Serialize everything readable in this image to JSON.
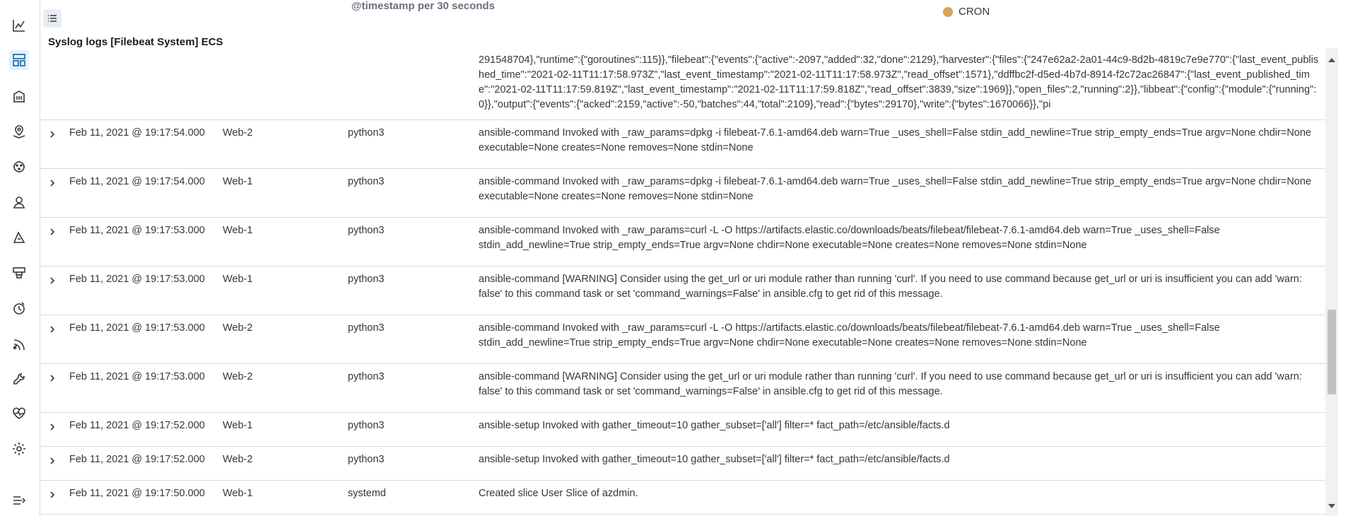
{
  "header": {
    "chart_xlabel": "@timestamp per 30 seconds",
    "legend_label": "CRON",
    "legend_color": "#d6a35c",
    "panel_title": "Syslog logs [Filebeat System] ECS"
  },
  "nav": {
    "icons": [
      "chart-icon",
      "dashboard-icon",
      "building-icon",
      "maps-icon",
      "ml-icon",
      "graph-icon",
      "security-icon",
      "infra-icon",
      "uptime-icon",
      "apm-icon",
      "dev-tools-icon",
      "monitoring-icon",
      "settings-icon",
      "collapse-icon"
    ]
  },
  "expanded_message": "291548704},\"runtime\":{\"goroutines\":115}},\"filebeat\":{\"events\":{\"active\":-2097,\"added\":32,\"done\":2129},\"harvester\":{\"files\":{\"247e62a2-2a01-44c9-8d2b-4819c7e9e770\":{\"last_event_published_time\":\"2021-02-11T11:17:58.973Z\",\"last_event_timestamp\":\"2021-02-11T11:17:58.973Z\",\"read_offset\":1571},\"ddffbc2f-d5ed-4b7d-8914-f2c72ac26847\":{\"last_event_published_time\":\"2021-02-11T11:17:59.819Z\",\"last_event_timestamp\":\"2021-02-11T11:17:59.818Z\",\"read_offset\":3839,\"size\":1969}},\"open_files\":2,\"running\":2}},\"libbeat\":{\"config\":{\"module\":{\"running\":0}},\"output\":{\"events\":{\"acked\":2159,\"active\":-50,\"batches\":44,\"total\":2109},\"read\":{\"bytes\":29170},\"write\":{\"bytes\":1670066}},\"pi",
  "rows": [
    {
      "time": "Feb 11, 2021 @ 19:17:54.000",
      "host": "Web-2",
      "process": "python3",
      "message": "ansible-command Invoked with _raw_params=dpkg -i filebeat-7.6.1-amd64.deb warn=True _uses_shell=False stdin_add_newline=True strip_empty_ends=True argv=None chdir=None executable=None creates=None removes=None stdin=None"
    },
    {
      "time": "Feb 11, 2021 @ 19:17:54.000",
      "host": "Web-1",
      "process": "python3",
      "message": "ansible-command Invoked with _raw_params=dpkg -i filebeat-7.6.1-amd64.deb warn=True _uses_shell=False stdin_add_newline=True strip_empty_ends=True argv=None chdir=None executable=None creates=None removes=None stdin=None"
    },
    {
      "time": "Feb 11, 2021 @ 19:17:53.000",
      "host": "Web-1",
      "process": "python3",
      "message": "ansible-command Invoked with _raw_params=curl -L -O https://artifacts.elastic.co/downloads/beats/filebeat/filebeat-7.6.1-amd64.deb warn=True _uses_shell=False stdin_add_newline=True strip_empty_ends=True argv=None chdir=None executable=None creates=None removes=None stdin=None"
    },
    {
      "time": "Feb 11, 2021 @ 19:17:53.000",
      "host": "Web-1",
      "process": "python3",
      "message": "ansible-command [WARNING] Consider using the get_url or uri module rather than running 'curl'.  If you need to use command because get_url or uri is insufficient you can add 'warn: false' to this command task or set 'command_warnings=False' in ansible.cfg to get rid of this message."
    },
    {
      "time": "Feb 11, 2021 @ 19:17:53.000",
      "host": "Web-2",
      "process": "python3",
      "message": "ansible-command Invoked with _raw_params=curl -L -O https://artifacts.elastic.co/downloads/beats/filebeat/filebeat-7.6.1-amd64.deb warn=True _uses_shell=False stdin_add_newline=True strip_empty_ends=True argv=None chdir=None executable=None creates=None removes=None stdin=None"
    },
    {
      "time": "Feb 11, 2021 @ 19:17:53.000",
      "host": "Web-2",
      "process": "python3",
      "message": "ansible-command [WARNING] Consider using the get_url or uri module rather than running 'curl'.  If you need to use command because get_url or uri is insufficient you can add 'warn: false' to this command task or set 'command_warnings=False' in ansible.cfg to get rid of this message."
    },
    {
      "time": "Feb 11, 2021 @ 19:17:52.000",
      "host": "Web-1",
      "process": "python3",
      "message": "ansible-setup Invoked with gather_timeout=10 gather_subset=['all'] filter=* fact_path=/etc/ansible/facts.d"
    },
    {
      "time": "Feb 11, 2021 @ 19:17:52.000",
      "host": "Web-2",
      "process": "python3",
      "message": "ansible-setup Invoked with gather_timeout=10 gather_subset=['all'] filter=* fact_path=/etc/ansible/facts.d"
    },
    {
      "time": "Feb 11, 2021 @ 19:17:50.000",
      "host": "Web-1",
      "process": "systemd",
      "message": "Created slice User Slice of azdmin."
    }
  ]
}
